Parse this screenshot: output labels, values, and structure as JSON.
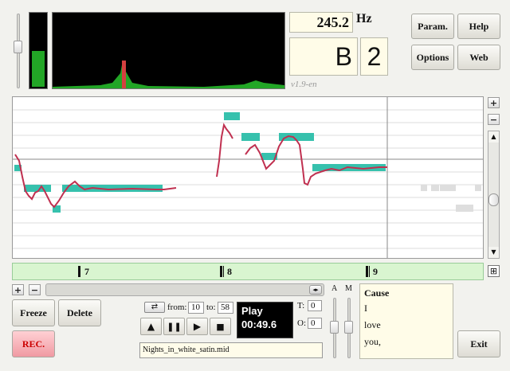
{
  "frequency": {
    "value": "245.2",
    "unit": "Hz"
  },
  "note": {
    "name": "B",
    "octave": "2"
  },
  "version": "v1.9-en",
  "buttons": {
    "param": "Param.",
    "help": "Help",
    "options": "Options",
    "web": "Web",
    "freeze": "Freeze",
    "delete": "Delete",
    "rec": "REC.",
    "exit": "Exit"
  },
  "measures": [
    "7",
    "8",
    "9"
  ],
  "loop": {
    "from_label": "from:",
    "from_value": "10",
    "to_label": "to:",
    "to_value": "58"
  },
  "player": {
    "state": "Play",
    "time": "00:49.6"
  },
  "tempo": {
    "t_label": "T:",
    "t_value": "0",
    "o_label": "O:",
    "o_value": "0"
  },
  "file": "Nights_in_white_satin.mid",
  "mixer_labels": {
    "a": "A",
    "m": "M"
  },
  "lyrics": {
    "title": "Cause",
    "lines": [
      "I",
      "love",
      "you,"
    ]
  },
  "scroll_buttons": {
    "zoom_in": "+",
    "zoom_out": "−"
  },
  "colors": {
    "note_bar": "#36c1ad",
    "pitch_curve": "#c03050",
    "level_green": "#22a626",
    "measure_bar": "#d9f5d0",
    "spectrum_bg": "#000000"
  },
  "icons": [
    "loop-icon",
    "metronome-icon",
    "pause-icon",
    "play-icon",
    "stop-icon",
    "fit-icon"
  ]
}
